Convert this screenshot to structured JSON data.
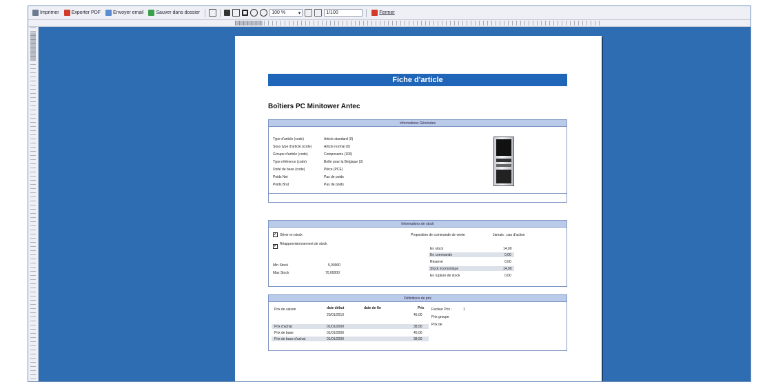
{
  "toolbar": {
    "print_label": "Imprimer",
    "pdf_label": "Exporter PDF",
    "email_label": "Envoyer email",
    "save_label": "Sauver dans dossier",
    "zoom_value": "100 %",
    "page_value": "1/100",
    "close_label": "Fermer"
  },
  "report": {
    "title": "Fiche d'article",
    "article_name": "Boîtiers PC  Minitower Antec",
    "general": {
      "header": "Informations Générales",
      "rows": [
        {
          "label": "Type d'article (code)",
          "value": "Article standard (0)"
        },
        {
          "label": "Sous type d'article (code)",
          "value": "Article normal (0)"
        },
        {
          "label": "Groupe d'article (code)",
          "value": "Composants (100)"
        },
        {
          "label": "Type référence (code)",
          "value": "Boîte pour la Belgique (3)"
        },
        {
          "label": "Unité de base (code)",
          "value": "Pièce (PCE)"
        },
        {
          "label": "Poids Net",
          "value": "Pas de poids"
        },
        {
          "label": "Poids Brut",
          "value": "Pas de poids"
        }
      ]
    },
    "stock": {
      "header": "Informations de stock",
      "manage_label": "Gérer en stock",
      "reorder_label": "Réapprovisionnement de stock",
      "proposal_label": "Proposition de commande de vente",
      "type_label": "Jamais : pas d'action",
      "min_label": "Min Stock",
      "min_value": "5,00000",
      "max_label": "Max Stock",
      "max_value": "70,00000",
      "rows": [
        {
          "label": "En stock",
          "value": "14,00"
        },
        {
          "label": "En commande",
          "value": "0,00"
        },
        {
          "label": "Réservé",
          "value": "0,00"
        },
        {
          "label": "Stock économique",
          "value": "14,00"
        },
        {
          "label": "En rupture de stock",
          "value": "0,00"
        }
      ]
    },
    "prices": {
      "header": "Définitions de prix",
      "col_start": "date début",
      "col_end": "date de fin",
      "col_price": "Prix",
      "factor_label": "Facteur Prix :",
      "factor_value": "1",
      "group_label": "Prix groupe",
      "of_label": "Prix de",
      "rows": [
        {
          "label": "Prix de saison",
          "start": "20/01/2010",
          "price": "45,00"
        },
        {
          "label": "Prix d'achat",
          "start": "01/01/2000",
          "price": "38,50"
        },
        {
          "label": "Prix de base",
          "start": "01/01/2000",
          "price": "45,00"
        },
        {
          "label": "Prix de base d'achat",
          "start": "01/01/2000",
          "price": "38,50"
        }
      ]
    }
  },
  "colors": {
    "background": "#2f6db3",
    "title_bar": "#1f65b8",
    "section_head": "#b9cbe9"
  }
}
